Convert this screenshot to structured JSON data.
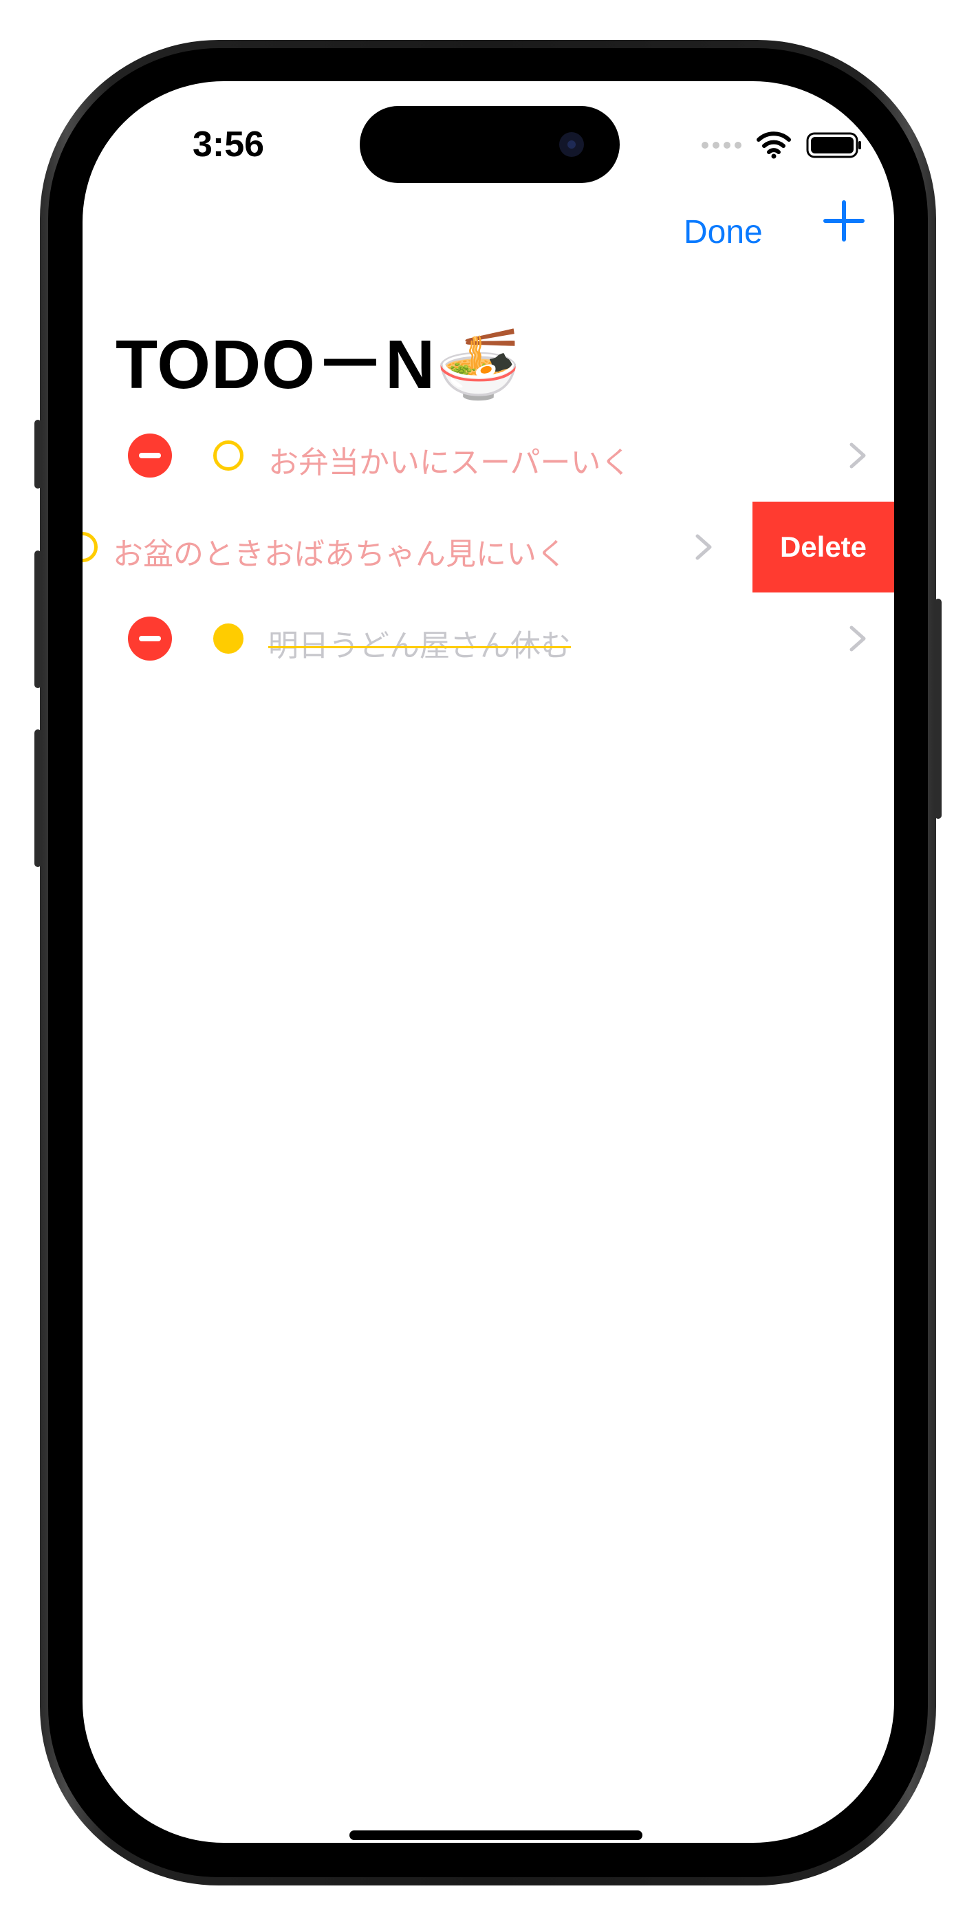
{
  "status": {
    "time": "3:56"
  },
  "nav": {
    "done_label": "Done",
    "add_icon": "plus-icon"
  },
  "title": "TODO－N🍜",
  "tasks": [
    {
      "label": "お弁当かいにスーパーいく",
      "completed": false,
      "icon": "chevron-right-icon"
    },
    {
      "label": "お盆のときおばあちゃん見にいく",
      "completed": false,
      "icon": "chevron-right-icon"
    },
    {
      "label": "明日うどん屋さん休む",
      "completed": true,
      "icon": "chevron-right-icon"
    }
  ],
  "swipe_action": {
    "label": "Delete"
  },
  "colors": {
    "accent": "#0a7aff",
    "delete": "#ff3b30",
    "check": "#ffcc00",
    "pending_text": "#f3a0a0",
    "completed_text": "#c7c7cc"
  }
}
